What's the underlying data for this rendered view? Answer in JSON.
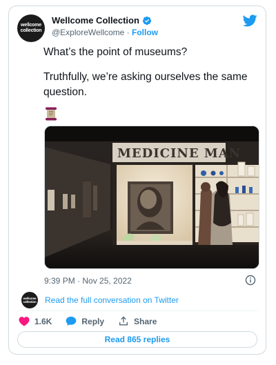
{
  "account": {
    "avatar_lines": [
      "wellcome",
      "collection"
    ],
    "name": "Wellcome Collection",
    "handle": "@ExploreWellcome",
    "separator": "·",
    "follow_label": "Follow"
  },
  "tweet": {
    "line1": "What’s the point of museums?",
    "line2": "Truthfully, we’re asking ourselves the same question.",
    "emoji": "scroll-emoji"
  },
  "media": {
    "sign_text": "MEDICINE MAN"
  },
  "meta": {
    "timestamp": "9:39 PM · Nov 25, 2022"
  },
  "conversation": {
    "link_text": "Read the full conversation on Twitter"
  },
  "actions": {
    "like_count": "1.6K",
    "reply_label": "Reply",
    "share_label": "Share"
  },
  "read_replies_label": "Read 865 replies",
  "colors": {
    "accent": "#1d9bf0",
    "like": "#f91880",
    "text": "#0f1419",
    "secondary": "#536471"
  }
}
